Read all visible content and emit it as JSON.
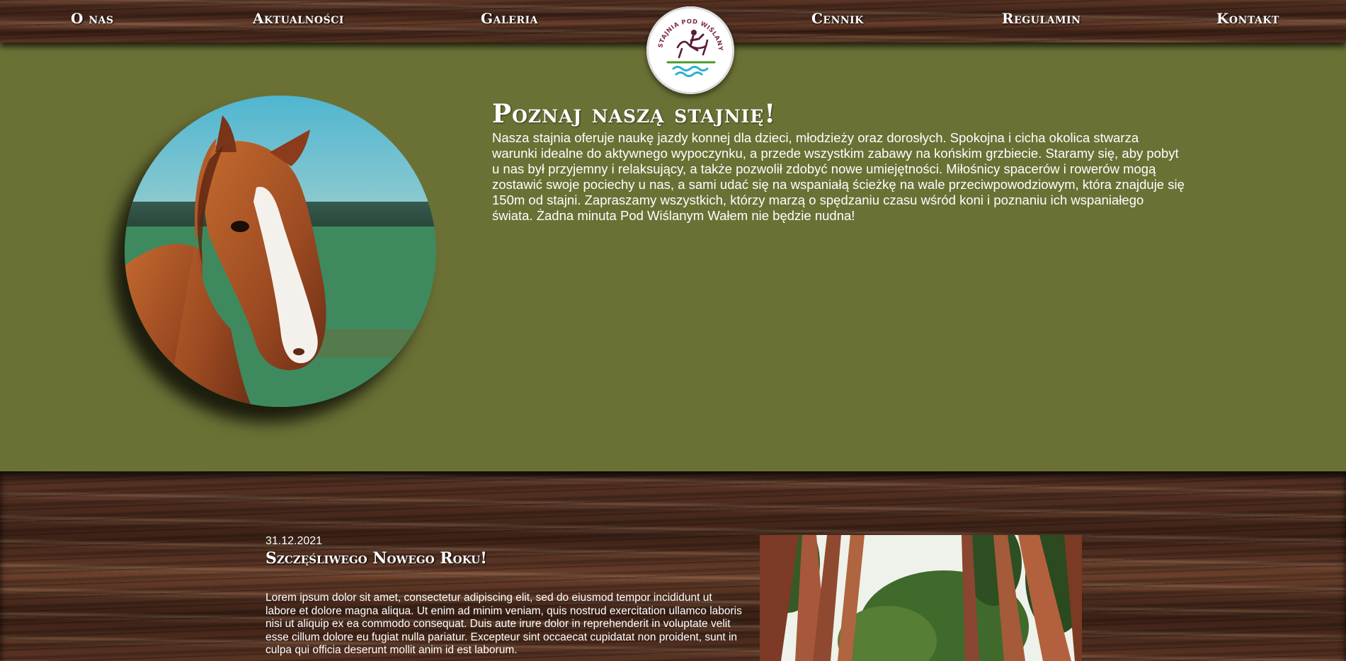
{
  "nav": {
    "items": [
      {
        "label": "O nas"
      },
      {
        "label": "Aktualności"
      },
      {
        "label": "Galeria"
      },
      {
        "label": "Cennik"
      },
      {
        "label": "Regulamin"
      },
      {
        "label": "Kontakt"
      }
    ]
  },
  "logo": {
    "text": "STAJNIA POD WIŚLANYM WAŁEM"
  },
  "about": {
    "title": "Poznaj naszą stajnię!",
    "text": "Nasza stajnia oferuje naukę jazdy konnej dla dzieci, młodzieży oraz dorosłych. Spokojna i cicha okolica stwarza warunki idealne do aktywnego wypoczynku, a przede wszystkim zabawy na końskim grzbiecie. Staramy się, aby pobyt u nas był przyjemny i relaksujący, a także pozwolił zdobyć nowe umiejętności. Miłośnicy spacerów i rowerów mogą zostawić swoje pociechy u nas, a sami udać się na wspaniałą ścieżkę na wale przeciwpowodziowym, która znajduje się 150m od stajni. Zapraszamy wszystkich, którzy marzą o spędzaniu czasu wśród koni i poznaniu ich wspaniałego świata. Żadna minuta Pod Wiślanym Wałem nie będzie nudna!"
  },
  "news": {
    "date": "31.12.2021",
    "title": "Szczęśliwego Nowego Roku!",
    "body": "Lorem ipsum dolor sit amet, consectetur adipiscing elit, sed do eiusmod tempor incididunt ut labore et dolore magna aliqua. Ut enim ad minim veniam, quis nostrud exercitation ullamco laboris nisi ut aliquip ex ea commodo consequat. Duis aute irure dolor in reprehenderit in voluptate velit esse cillum dolore eu fugiat nulla pariatur. Excepteur sint occaecat cupidatat non proident, sunt in culpa qui officia deserunt mollit anim id est laborum."
  },
  "colors": {
    "green_bg": "#6b7135",
    "wood": "#4a2a1a",
    "text": "#ffffff"
  }
}
